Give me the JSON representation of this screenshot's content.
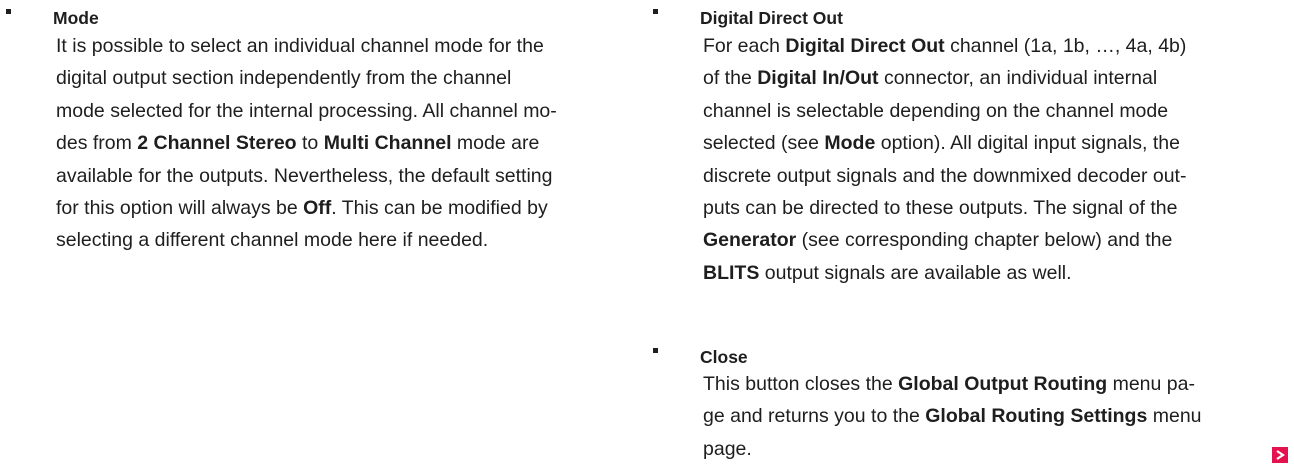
{
  "left": {
    "mode": {
      "title": "Mode",
      "lines": [
        [
          {
            "t": "It is possible to select an individual channel mode for the"
          }
        ],
        [
          {
            "t": "digital output section independently from the channel"
          }
        ],
        [
          {
            "t": "mode selected for the internal processing. All channel mo-"
          }
        ],
        [
          {
            "t": "des from "
          },
          {
            "t": "2 Channel Stereo",
            "b": true
          },
          {
            "t": " to "
          },
          {
            "t": "Multi Channel",
            "b": true
          },
          {
            "t": " mode are"
          }
        ],
        [
          {
            "t": "available for the outputs. Nevertheless, the default setting"
          }
        ],
        [
          {
            "t": "for this option will always be "
          },
          {
            "t": "Off",
            "b": true
          },
          {
            "t": ". This can be modified by"
          }
        ],
        [
          {
            "t": "selecting a different channel mode here if needed."
          }
        ]
      ]
    }
  },
  "right": {
    "digital_direct_out": {
      "title": "Digital Direct Out",
      "lines": [
        [
          {
            "t": "For each "
          },
          {
            "t": "Digital Direct Out",
            "b": true
          },
          {
            "t": " channel (1a, 1b, …, 4a, 4b)"
          }
        ],
        [
          {
            "t": "of the "
          },
          {
            "t": "Digital In/Out",
            "b": true
          },
          {
            "t": " connector, an individual internal"
          }
        ],
        [
          {
            "t": "channel is selectable depending on the channel mode"
          }
        ],
        [
          {
            "t": "selected (see "
          },
          {
            "t": "Mode",
            "b": true
          },
          {
            "t": " option). All digital input signals, the"
          }
        ],
        [
          {
            "t": "discrete output signals and the downmixed decoder out-"
          }
        ],
        [
          {
            "t": "puts can be directed to these outputs. The signal of the"
          }
        ],
        [
          {
            "t": "Generator",
            "b": true
          },
          {
            "t": " (see corresponding chapter below) and the"
          }
        ],
        [
          {
            "t": "BLITS",
            "b": true
          },
          {
            "t": " output signals are available as well."
          }
        ]
      ]
    },
    "close": {
      "title": "Close",
      "lines": [
        [
          {
            "t": "This button closes the "
          },
          {
            "t": "Global Output Routing",
            "b": true
          },
          {
            "t": " menu pa-"
          }
        ],
        [
          {
            "t": "ge and returns you to the "
          },
          {
            "t": "Global Routing Settings",
            "b": true
          },
          {
            "t": " menu"
          }
        ],
        [
          {
            "t": "page."
          }
        ]
      ]
    }
  },
  "nav": {
    "next_icon": "chevron-right-icon",
    "accent_color": "#e4134f"
  }
}
